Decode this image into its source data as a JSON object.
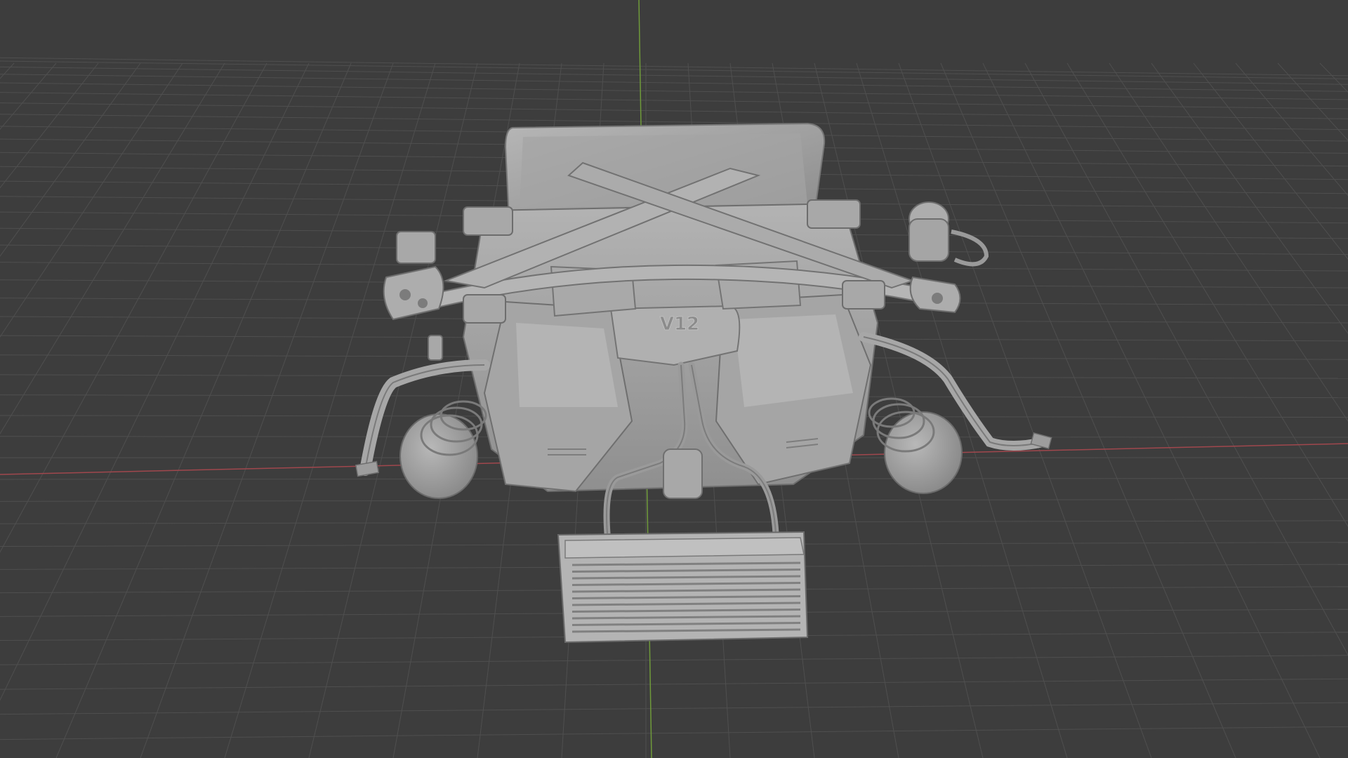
{
  "viewport": {
    "background": "#3d3d3d",
    "grid_color": "#4f4f4f",
    "x_axis_color": "#a0474d",
    "y_axis_color": "#6f9a3a"
  },
  "model": {
    "engraving": "V12",
    "base_color": "#9e9e9e",
    "highlight_color": "#b8b8b8",
    "shadow_color": "#7a7a7a"
  }
}
